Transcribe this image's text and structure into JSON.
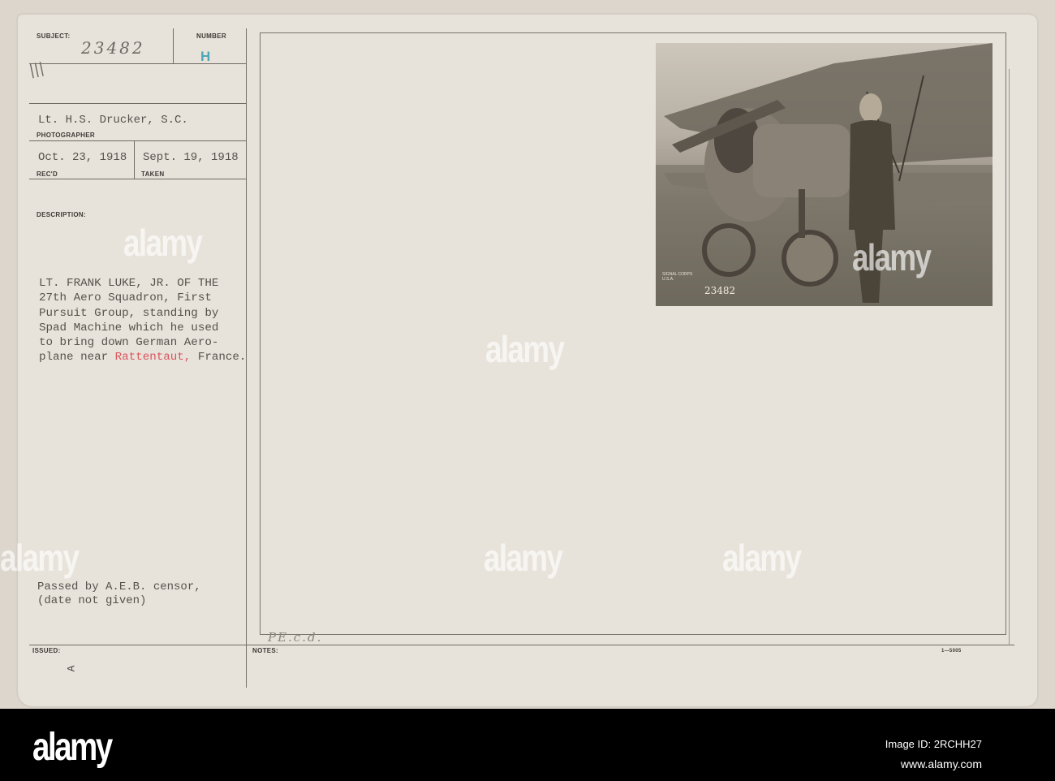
{
  "card": {
    "subject_label": "SUBJECT:",
    "subject_value": "23482",
    "subject_mark": "|||",
    "number_label": "NUMBER",
    "number_value": "H",
    "photographer_value": "Lt. H.S. Drucker, S.C.",
    "photographer_label": "PHOTOGRAPHER",
    "recd_value": "Oct. 23, 1918",
    "recd_label": "REC'D",
    "taken_value": "Sept. 19, 1918",
    "taken_label": "TAKEN",
    "description_label": "DESCRIPTION:",
    "description_lines": [
      "LT. FRANK LUKE, JR. OF THE",
      "27th Aero Squadron, First",
      "Pursuit Group, standing by",
      "Spad Machine which he used",
      "to bring down German Aero-"
    ],
    "description_last_prefix": "plane near ",
    "description_place": "Rattentaut,",
    "description_last_suffix": " France.",
    "censor_lines": [
      "Passed by A.E.B. censor,",
      "(date not given)"
    ],
    "issued_label": "ISSUED:",
    "issued_value": "A",
    "notes_label": "NOTES:",
    "notes_handwriting": "PE.c.d.",
    "form_number": "1—5005",
    "photo_stamp_number": "23482",
    "photo_stamp_text": "SIGNAL CORPS U.S.A."
  },
  "colors": {
    "place_highlight": "#d9555e",
    "number_stamp": "#4fa6b8"
  },
  "watermark": "alamy",
  "footer": {
    "logo": "alamy",
    "image_id": "Image ID: 2RCHH27",
    "url": "www.alamy.com"
  }
}
